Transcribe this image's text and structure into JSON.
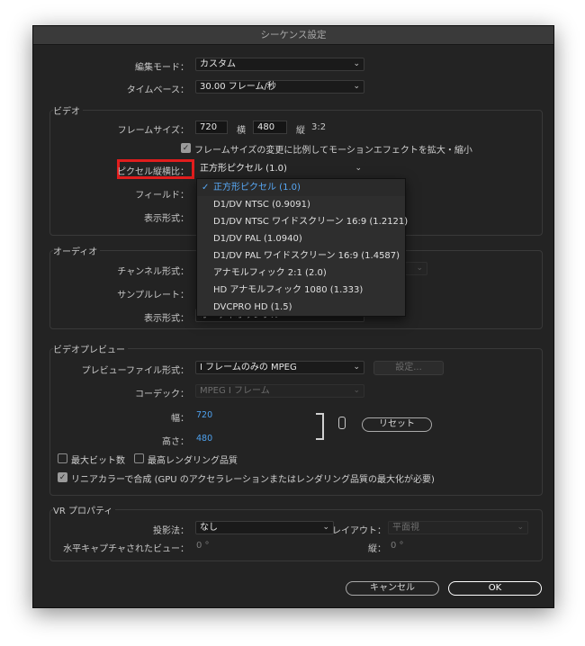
{
  "window": {
    "title": "シーケンス設定"
  },
  "top": {
    "edit_mode_label": "編集モード：",
    "edit_mode_value": "カスタム",
    "timebase_label": "タイムベース：",
    "timebase_value": "30.00  フレーム/秒"
  },
  "video": {
    "group_title": "ビデオ",
    "frame_size_label": "フレームサイズ：",
    "width": "720",
    "horizontal_label": "横",
    "height": "480",
    "vertical_label": "縦",
    "ratio": "3:2",
    "scale_checkbox_label": "フレームサイズの変更に比例してモーションエフェクトを拡大・縮小",
    "pixel_aspect_label": "ピクセル縦横比：",
    "pixel_aspect_value": "正方形ピクセル (1.0)",
    "fields_label": "フィールド：",
    "display_format_label": "表示形式："
  },
  "pixel_aspect_options": [
    "正方形ピクセル (1.0)",
    "D1/DV NTSC (0.9091)",
    "D1/DV NTSC ワイドスクリーン 16:9 (1.2121)",
    "D1/DV PAL (1.0940)",
    "D1/DV PAL ワイドスクリーン 16:9 (1.4587)",
    "アナモルフィック 2:1 (2.0)",
    "HD アナモルフィック 1080 (1.333)",
    "DVCPRO HD (1.5)"
  ],
  "audio": {
    "group_title": "オーディオ",
    "channel_format_label": "チャンネル形式：",
    "sample_rate_label": "サンプルレート：",
    "display_format_label": "表示形式：",
    "display_format_value": "オーディオサンプル"
  },
  "preview": {
    "group_title": "ビデオプレビュー",
    "file_format_label": "プレビューファイル形式：",
    "file_format_value": "I フレームのみの MPEG",
    "settings_button": "設定...",
    "codec_label": "コーデック：",
    "codec_value": "MPEG I フレーム",
    "width_label": "幅：",
    "width_value": "720",
    "height_label": "高さ：",
    "height_value": "480",
    "reset_button": "リセット",
    "max_bit_depth": "最大ビット数",
    "max_render_quality": "最高レンダリング品質",
    "linear_color": "リニアカラーで合成 (GPU のアクセラレーションまたはレンダリング品質の最大化が必要)"
  },
  "vr": {
    "group_title": "VR プロパティ",
    "projection_label": "投影法：",
    "projection_value": "なし",
    "layout_label": "レイアウト：",
    "layout_value": "平面視",
    "h_view_label": "水平キャプチャされたビュー：",
    "h_view_value": "0 °",
    "vertical_label": "縦：",
    "vertical_value": "0 °"
  },
  "footer": {
    "cancel": "キャンセル",
    "ok": "OK"
  },
  "icons": {
    "chevron": "chevron-down-icon",
    "check": "checkmark-icon",
    "link": "chain-link-icon"
  }
}
